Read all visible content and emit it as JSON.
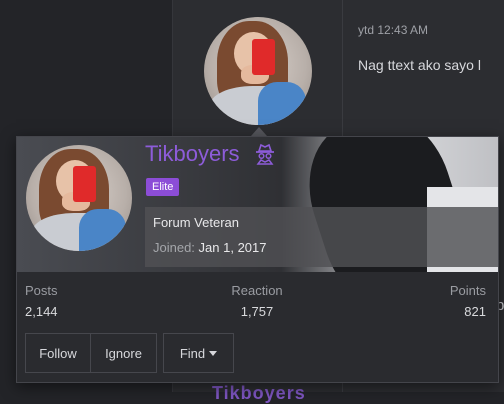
{
  "post": {
    "time": "ytd 12:43 AM",
    "message": "Nag ttext ako sayo l",
    "stray_char": "b",
    "bottom_ghost_name": "Tikboyers"
  },
  "profile": {
    "username": "Tikboyers",
    "username_color": "#8d5cd9",
    "badge": "Elite",
    "badge_color": "#8c4dd7",
    "title": "Forum Veteran",
    "joined_label": "Joined:",
    "joined_value": "Jan 1, 2017"
  },
  "stats": {
    "posts_label": "Posts",
    "posts_value": "2,144",
    "reaction_label": "Reaction",
    "reaction_value": "1,757",
    "points_label": "Points",
    "points_value": "821"
  },
  "actions": {
    "follow": "Follow",
    "ignore": "Ignore",
    "find": "Find"
  },
  "icons": {
    "user_badge": "spy-icon",
    "find_caret": "chevron-down-icon"
  }
}
